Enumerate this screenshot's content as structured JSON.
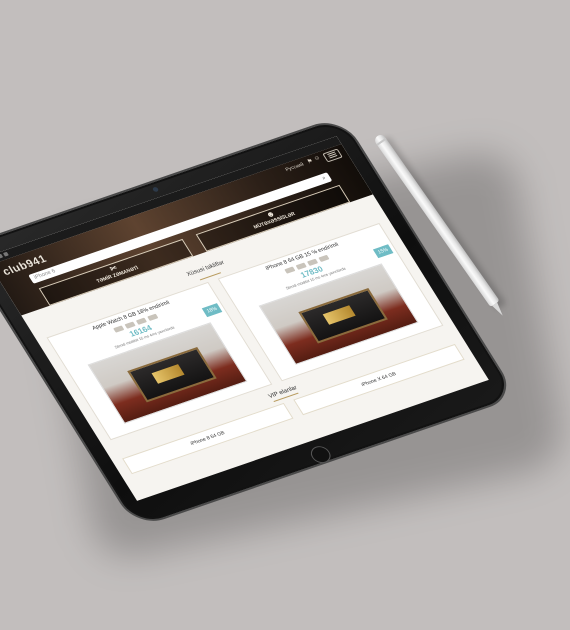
{
  "site": {
    "logo": "club941",
    "language": "Русский",
    "search_placeholder": "iPhone 6",
    "buttons": [
      {
        "label": "TƏMİR ZƏMANƏTİ"
      },
      {
        "label": "MÜTƏXƏSSİSLƏR"
      }
    ]
  },
  "auctions": {
    "title": "Xüsusi təkliflər",
    "items": [
      {
        "name": "Apple Watch 8 GB 18% endirimli",
        "price": "16164",
        "note": "Stendi müddət 15 ms 4ms yaxınlarda",
        "discount": "18%"
      },
      {
        "name": "iPhone 8 64 GB 15 % endirimli",
        "price": "17830",
        "note": "Stendi müddət 15 ms 4ms yaxınlarda",
        "discount": "15%"
      }
    ]
  },
  "vip": {
    "title": "VIP elanlar",
    "items": [
      {
        "label": "iPhone 8 64 GB"
      },
      {
        "label": "iPhone X 64 GB"
      }
    ]
  },
  "colors": {
    "accent": "#6fbcc5",
    "gold": "#b89b5e",
    "bezel": "#111111",
    "background": "#c2bebd"
  }
}
